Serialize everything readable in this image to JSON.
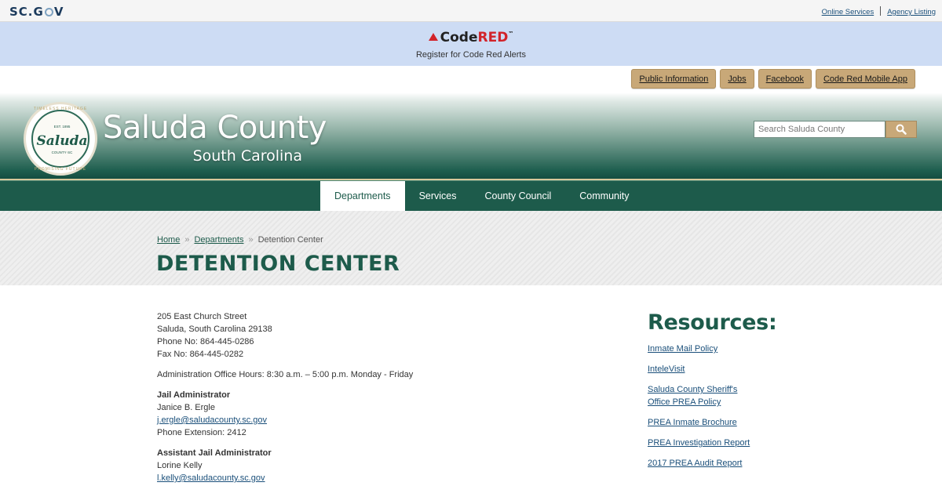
{
  "scgov": {
    "logo_prefix": "SC.G",
    "logo_suffix": "V",
    "links": [
      "Online Services",
      "Agency Listing"
    ]
  },
  "codered": {
    "logo_code": "Code",
    "logo_red": "RED",
    "logo_tm": "™",
    "subtitle": "Register for Code Red Alerts"
  },
  "quick_links": [
    "Public Information",
    "Jobs",
    "Facebook",
    "Code Red Mobile App"
  ],
  "header": {
    "title": "Saluda County",
    "subtitle": "South Carolina",
    "seal": {
      "word": "Saluda",
      "est": "EST. 1895",
      "county": "COUNTY·SC",
      "top_text": "TIMELESS HERITAGE",
      "bottom_text": "PROMISING FUTURE"
    },
    "search_placeholder": "Search Saluda County"
  },
  "nav": {
    "items": [
      "Departments",
      "Services",
      "County Council",
      "Community"
    ],
    "active": "Departments"
  },
  "breadcrumb": {
    "home": "Home",
    "separator": "»",
    "departments": "Departments",
    "current": "Detention Center"
  },
  "page_title": "DETENTION CENTER",
  "content": {
    "address_line1": "205 East Church Street",
    "address_line2": "Saluda, South Carolina  29138",
    "phone": "Phone No: 864-445-0286",
    "fax": "Fax No: 864-445-0282",
    "hours": "Administration Office Hours: 8:30 a.m. – 5:00 p.m. Monday - Friday",
    "jail_admin": {
      "title": "Jail Administrator",
      "name": "Janice B. Ergle",
      "email": "j.ergle@saludacounty.sc.gov",
      "extension": "Phone Extension: 2412"
    },
    "asst_admin": {
      "title": "Assistant Jail Administrator",
      "name": "Lorine Kelly",
      "email": "l.kelly@saludacounty.sc.gov"
    }
  },
  "resources": {
    "heading": "Resources:",
    "links": [
      "Inmate Mail Policy",
      "InteleVisit",
      "Saluda County Sheriff's Office PREA Policy",
      "PREA Inmate Brochure",
      "PREA Investigation Report",
      "2017 PREA Audit Report"
    ]
  },
  "colors": {
    "brand_green": "#1d5b4b",
    "accent_tan": "#c8a878",
    "codered_red": "#d2232a",
    "banner_blue": "#cddcf4"
  }
}
